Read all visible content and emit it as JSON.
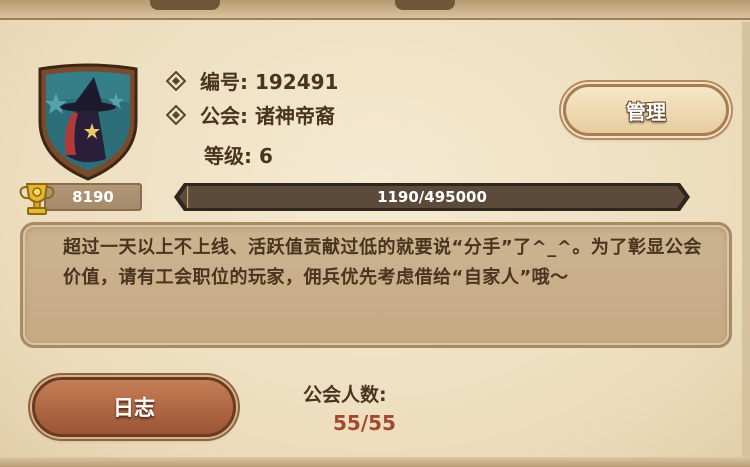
{
  "guild": {
    "id_label": "编号: 192491",
    "guild_label": "公会: 诸神帝裔",
    "level_label": "等级: 6",
    "manage_label": "管理",
    "score": "8190",
    "progress": {
      "text": "1190/495000",
      "current": 1190,
      "max": 495000
    },
    "notice": "超过一天以上不上线、活跃值贡献过低的就要说“分手”了^_^。为了彰显公会价值，请有工会职位的玩家，佣兵优先考虑借给“自家人”哦～",
    "log_label": "日志",
    "members_label": "公会人数:",
    "members_count": "55/55"
  },
  "icons": {
    "emblem": "witch-hat-shield-icon",
    "diamond": "diamond-bullet-icon",
    "trophy": "trophy-icon"
  },
  "colors": {
    "text_dark": "#4a3420",
    "members_count": "#a3492e",
    "progress_track": "#5c4a3b",
    "emblem_border": "#7a4a2c"
  }
}
